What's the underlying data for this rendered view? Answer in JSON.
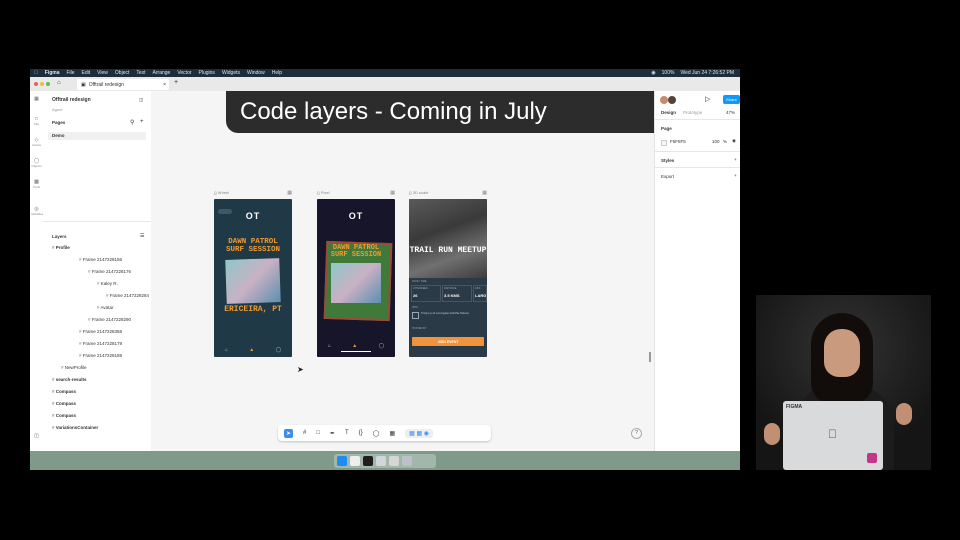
{
  "menubar": {
    "app_name": "Figma",
    "menus": [
      "File",
      "Edit",
      "View",
      "Object",
      "Text",
      "Arrange",
      "Vector",
      "Plugins",
      "Widgets",
      "Window",
      "Help"
    ],
    "battery": "100%",
    "clock": "Wed Jun 24 7:26:52 PM"
  },
  "tabbar": {
    "tab_title": "Offtrail redesign",
    "add_tab": "+"
  },
  "toolrail": [
    "File",
    "Assets",
    "Objects",
    "Tools",
    "Variables"
  ],
  "leftpanel": {
    "file_name": "Offtrail redesign",
    "subtitle": "Agent",
    "pages_heading": "Pages",
    "page_item": "Demo",
    "layers_heading": "Layers",
    "layers": [
      {
        "label": "Profile",
        "indent": 0,
        "bold": true
      },
      {
        "label": "Frame 2147228156",
        "indent": 3,
        "bold": false
      },
      {
        "label": "Frame 2147228176",
        "indent": 4,
        "bold": false
      },
      {
        "label": "Kaley R.",
        "indent": 5,
        "bold": false
      },
      {
        "label": "Frame 2147228284",
        "indent": 6,
        "bold": false
      },
      {
        "label": "Avatar",
        "indent": 5,
        "bold": false
      },
      {
        "label": "Frame 2147228290",
        "indent": 4,
        "bold": false
      },
      {
        "label": "Frame 2147228358",
        "indent": 3,
        "bold": false
      },
      {
        "label": "Frame 2147228179",
        "indent": 3,
        "bold": false
      },
      {
        "label": "Frame 2147228188",
        "indent": 3,
        "bold": false
      },
      {
        "label": "NewProfile",
        "indent": 1,
        "bold": false
      },
      {
        "label": "search-results",
        "indent": 0,
        "bold": true
      },
      {
        "label": "Compass",
        "indent": 0,
        "bold": true
      },
      {
        "label": "Compass",
        "indent": 0,
        "bold": true
      },
      {
        "label": "Compass",
        "indent": 0,
        "bold": true
      },
      {
        "label": "VariationsContainer",
        "indent": 0,
        "bold": true
      }
    ]
  },
  "banner": {
    "text": "Code layers - Coming in July"
  },
  "frames": [
    {
      "label": "Wheel",
      "logo": "OT",
      "title": "DAWN PATROL SURF SESSION",
      "place": "ERICEIRA, PT"
    },
    {
      "label": "Pixel",
      "logo": "OT",
      "title": "DAWN PATROL SURF SESSION"
    },
    {
      "label": "3D scale",
      "title": "TRAIL RUN MEETUP",
      "detail_heading": "DATE / TIME",
      "cells": [
        {
          "label": "ATTENDEES",
          "value": "26"
        },
        {
          "label": "DISTANCE",
          "value": "3.5 KMS"
        },
        {
          "label": "DIFF",
          "value": "LARG"
        }
      ],
      "section_heading": "WHO",
      "section_text": "Trinity Lyn of Los Angeles & Richie Talmore",
      "join_label": "JOIN EVENT",
      "meta_heading": "HOSTED BY"
    }
  ],
  "rightpanel": {
    "share_label": "Share",
    "tabs": [
      "Design",
      "Prototype"
    ],
    "zoom": "47%",
    "page_heading": "Page",
    "page_color": "F5F5F5",
    "page_opacity": "100",
    "opacity_unit": "%",
    "styles_heading": "Styles",
    "export_heading": "Export"
  },
  "bottomtool": {
    "help": "?"
  },
  "presenter": {
    "laptop_sticker": "FIGMA"
  }
}
